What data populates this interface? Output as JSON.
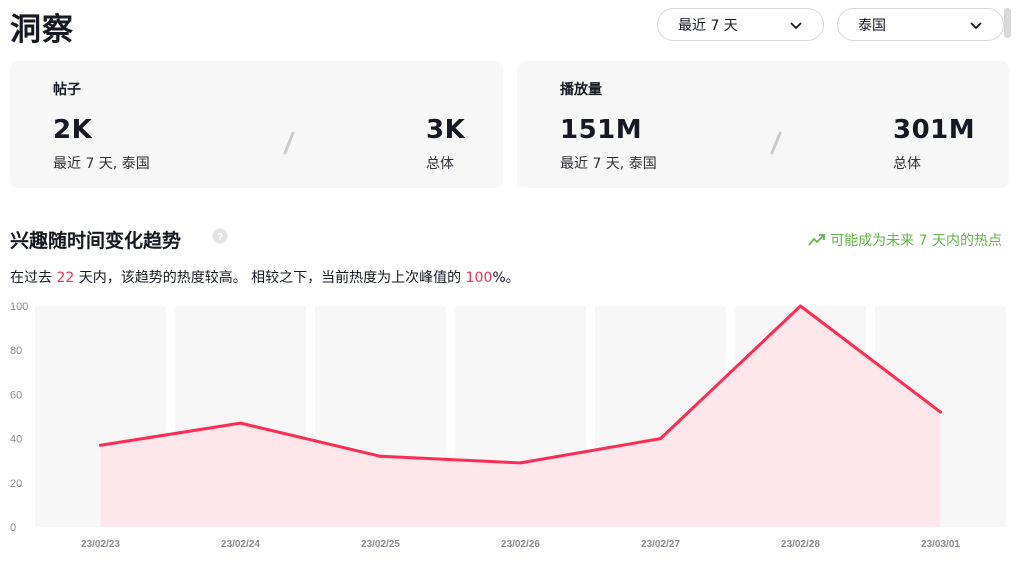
{
  "header": {
    "title": "洞察",
    "period_select": {
      "value": "最近 7 天"
    },
    "region_select": {
      "value": "泰国"
    }
  },
  "stats": {
    "posts": {
      "label": "帖子",
      "recent_value": "2K",
      "recent_caption": "最近 7 天, 泰国",
      "total_value": "3K",
      "total_caption": "总体"
    },
    "views": {
      "label": "播放量",
      "recent_value": "151M",
      "recent_caption": "最近 7 天, 泰国",
      "total_value": "301M",
      "total_caption": "总体"
    }
  },
  "interest": {
    "title": "兴趣随时间变化趋势",
    "trend_badge": "可能成为未来 7 天内的热点",
    "desc_part1": "在过去 ",
    "desc_days": "22",
    "desc_part2": " 天内，该趋势的热度较高。 相较之下，当前热度为上次峰值的 ",
    "desc_percent": "100",
    "desc_part3": "%。"
  },
  "colors": {
    "accent": "#fe2c55",
    "trend_green": "#65b64a",
    "card_bg": "#f7f7f8",
    "fill": "#fde4e8"
  },
  "icons": {
    "dropdown": "chevron-down-icon",
    "help": "question-circle-icon",
    "trend": "trending-up-icon"
  },
  "chart_data": {
    "type": "area",
    "categories": [
      "23/02/23",
      "23/02/24",
      "23/02/25",
      "23/02/26",
      "23/02/27",
      "23/02/28",
      "23/03/01"
    ],
    "values": [
      37,
      47,
      32,
      29,
      40,
      100,
      52
    ],
    "ylim": [
      0,
      100
    ],
    "yticks": [
      0,
      20,
      40,
      60,
      80,
      100
    ],
    "grid": "column-bands",
    "legend": "none"
  }
}
